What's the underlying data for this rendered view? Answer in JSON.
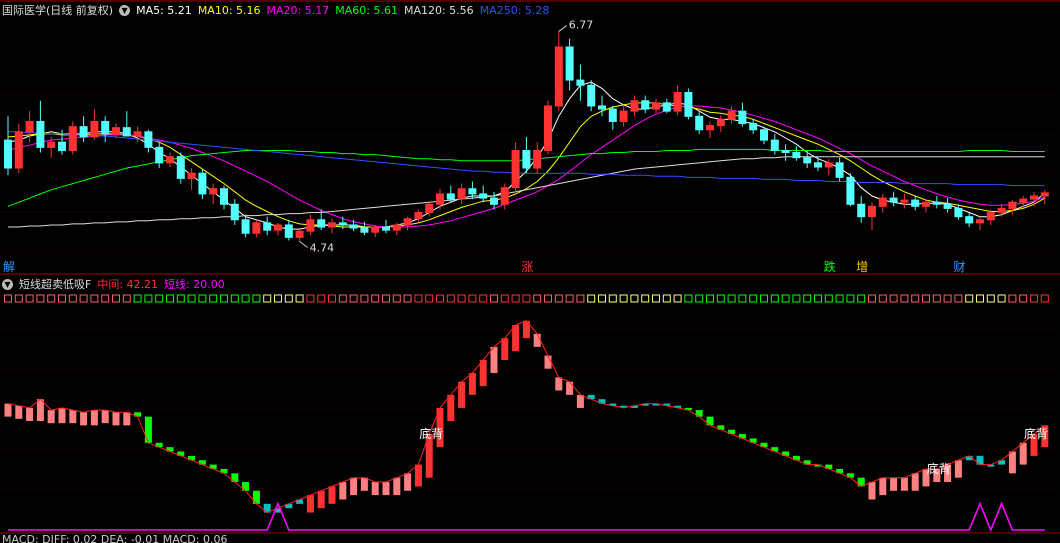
{
  "main_panel": {
    "title": "国际医学(日线 前复权)",
    "ma_labels": [
      {
        "text": "MA5: 5.21",
        "color": "#ffffff"
      },
      {
        "text": "MA10: 5.16",
        "color": "#ffff00"
      },
      {
        "text": "MA20: 5.17",
        "color": "#ff00ff"
      },
      {
        "text": "MA60: 5.61",
        "color": "#00ff00"
      },
      {
        "text": "MA120: 5.56",
        "color": "#dddddd"
      },
      {
        "text": "MA250: 5.28",
        "color": "#3050ff"
      }
    ],
    "high_label": "6.77",
    "low_label": "4.74",
    "markers": [
      {
        "text": "解",
        "index": 0,
        "color": "#3399ff"
      },
      {
        "text": "涨",
        "index": 48,
        "color": "#ff3333"
      },
      {
        "text": "跌",
        "index": 76,
        "color": "#00ff00"
      },
      {
        "text": "增",
        "index": 79,
        "color": "#ffcc00"
      },
      {
        "text": "财",
        "index": 88,
        "color": "#3399ff"
      }
    ]
  },
  "indicator_panel": {
    "title": "短线超卖低吸F",
    "mid_label": "中间: 42.21",
    "short_label": "短线: 20.00",
    "mid_color": "#ff3333",
    "short_color": "#ff00ff",
    "annotation_text": "底背",
    "annotation_indices": [
      39,
      86,
      95
    ]
  },
  "bottom_label": "MACD: DIFF: 0.02  DEA: -0.01  MACD: 0.06",
  "chart_data": {
    "type": "candlestick",
    "ohlc": [
      [
        5.72,
        5.95,
        5.38,
        5.45
      ],
      [
        5.45,
        5.88,
        5.4,
        5.8
      ],
      [
        5.8,
        6.0,
        5.7,
        5.9
      ],
      [
        5.9,
        6.1,
        5.6,
        5.65
      ],
      [
        5.65,
        5.75,
        5.55,
        5.7
      ],
      [
        5.7,
        5.82,
        5.58,
        5.62
      ],
      [
        5.62,
        5.9,
        5.58,
        5.85
      ],
      [
        5.85,
        5.95,
        5.7,
        5.75
      ],
      [
        5.75,
        6.02,
        5.72,
        5.9
      ],
      [
        5.9,
        5.95,
        5.7,
        5.78
      ],
      [
        5.78,
        5.88,
        5.74,
        5.84
      ],
      [
        5.84,
        6.0,
        5.8,
        5.76
      ],
      [
        5.76,
        5.85,
        5.7,
        5.8
      ],
      [
        5.8,
        5.82,
        5.6,
        5.65
      ],
      [
        5.65,
        5.7,
        5.45,
        5.5
      ],
      [
        5.5,
        5.6,
        5.46,
        5.56
      ],
      [
        5.56,
        5.6,
        5.3,
        5.35
      ],
      [
        5.35,
        5.45,
        5.24,
        5.4
      ],
      [
        5.4,
        5.44,
        5.15,
        5.2
      ],
      [
        5.2,
        5.3,
        5.1,
        5.25
      ],
      [
        5.25,
        5.28,
        5.05,
        5.1
      ],
      [
        5.1,
        5.15,
        4.9,
        4.95
      ],
      [
        4.95,
        5.0,
        4.78,
        4.82
      ],
      [
        4.82,
        4.95,
        4.78,
        4.92
      ],
      [
        4.92,
        4.98,
        4.8,
        4.85
      ],
      [
        4.85,
        4.92,
        4.8,
        4.9
      ],
      [
        4.9,
        4.95,
        4.75,
        4.78
      ],
      [
        4.78,
        4.86,
        4.74,
        4.84
      ],
      [
        4.84,
        5.0,
        4.8,
        4.95
      ],
      [
        4.95,
        5.05,
        4.85,
        4.88
      ],
      [
        4.88,
        4.96,
        4.82,
        4.92
      ],
      [
        4.92,
        4.98,
        4.86,
        4.9
      ],
      [
        4.9,
        4.95,
        4.84,
        4.87
      ],
      [
        4.87,
        4.93,
        4.8,
        4.83
      ],
      [
        4.83,
        4.9,
        4.78,
        4.88
      ],
      [
        4.88,
        4.95,
        4.82,
        4.85
      ],
      [
        4.85,
        4.92,
        4.8,
        4.9
      ],
      [
        4.9,
        4.98,
        4.85,
        4.96
      ],
      [
        4.96,
        5.05,
        4.92,
        5.02
      ],
      [
        5.02,
        5.12,
        4.98,
        5.1
      ],
      [
        5.1,
        5.25,
        5.05,
        5.2
      ],
      [
        5.2,
        5.28,
        5.12,
        5.15
      ],
      [
        5.15,
        5.3,
        5.1,
        5.25
      ],
      [
        5.25,
        5.32,
        5.15,
        5.2
      ],
      [
        5.2,
        5.28,
        5.12,
        5.16
      ],
      [
        5.16,
        5.22,
        5.05,
        5.1
      ],
      [
        5.1,
        5.3,
        5.05,
        5.26
      ],
      [
        5.26,
        5.7,
        5.2,
        5.62
      ],
      [
        5.62,
        5.75,
        5.4,
        5.45
      ],
      [
        5.45,
        5.7,
        5.4,
        5.62
      ],
      [
        5.62,
        6.1,
        5.58,
        6.05
      ],
      [
        6.05,
        6.77,
        6.0,
        6.62
      ],
      [
        6.62,
        6.7,
        6.2,
        6.3
      ],
      [
        6.3,
        6.45,
        6.1,
        6.25
      ],
      [
        6.25,
        6.3,
        6.0,
        6.05
      ],
      [
        6.05,
        6.15,
        5.95,
        6.02
      ],
      [
        6.02,
        6.05,
        5.82,
        5.9
      ],
      [
        5.9,
        6.05,
        5.85,
        6.0
      ],
      [
        6.0,
        6.15,
        5.95,
        6.1
      ],
      [
        6.1,
        6.15,
        5.98,
        6.02
      ],
      [
        6.02,
        6.12,
        5.98,
        6.08
      ],
      [
        6.08,
        6.12,
        5.98,
        6.0
      ],
      [
        6.0,
        6.25,
        5.96,
        6.18
      ],
      [
        6.18,
        6.22,
        5.92,
        5.95
      ],
      [
        5.95,
        6.0,
        5.78,
        5.82
      ],
      [
        5.82,
        5.9,
        5.74,
        5.86
      ],
      [
        5.86,
        5.96,
        5.8,
        5.92
      ],
      [
        5.92,
        6.05,
        5.88,
        6.0
      ],
      [
        6.0,
        6.08,
        5.85,
        5.88
      ],
      [
        5.88,
        5.92,
        5.78,
        5.82
      ],
      [
        5.82,
        5.85,
        5.68,
        5.72
      ],
      [
        5.72,
        5.78,
        5.58,
        5.62
      ],
      [
        5.62,
        5.68,
        5.52,
        5.6
      ],
      [
        5.6,
        5.66,
        5.52,
        5.55
      ],
      [
        5.55,
        5.62,
        5.45,
        5.5
      ],
      [
        5.5,
        5.56,
        5.42,
        5.46
      ],
      [
        5.46,
        5.54,
        5.38,
        5.5
      ],
      [
        5.5,
        5.55,
        5.32,
        5.36
      ],
      [
        5.36,
        5.4,
        5.08,
        5.1
      ],
      [
        5.1,
        5.18,
        4.92,
        4.98
      ],
      [
        4.98,
        5.12,
        4.85,
        5.08
      ],
      [
        5.08,
        5.2,
        5.02,
        5.16
      ],
      [
        5.16,
        5.22,
        5.08,
        5.12
      ],
      [
        5.12,
        5.2,
        5.06,
        5.14
      ],
      [
        5.14,
        5.18,
        5.04,
        5.08
      ],
      [
        5.08,
        5.15,
        5.02,
        5.12
      ],
      [
        5.12,
        5.18,
        5.06,
        5.1
      ],
      [
        5.1,
        5.16,
        5.02,
        5.06
      ],
      [
        5.06,
        5.1,
        4.95,
        4.98
      ],
      [
        4.98,
        5.02,
        4.88,
        4.92
      ],
      [
        4.92,
        4.98,
        4.85,
        4.95
      ],
      [
        4.95,
        5.05,
        4.9,
        5.02
      ],
      [
        5.02,
        5.1,
        4.98,
        5.06
      ],
      [
        5.06,
        5.14,
        5.0,
        5.12
      ],
      [
        5.12,
        5.18,
        5.06,
        5.15
      ],
      [
        5.15,
        5.22,
        5.08,
        5.18
      ],
      [
        5.18,
        5.24,
        5.1,
        5.21
      ]
    ],
    "ma": {
      "MA5": [
        5.7,
        5.72,
        5.76,
        5.78,
        5.8,
        5.78,
        5.78,
        5.78,
        5.8,
        5.8,
        5.8,
        5.78,
        5.74,
        5.68,
        5.6,
        5.54,
        5.46,
        5.38,
        5.3,
        5.22,
        5.14,
        5.06,
        4.98,
        4.95,
        4.92,
        4.88,
        4.86,
        4.86,
        4.88,
        4.9,
        4.9,
        4.9,
        4.9,
        4.88,
        4.88,
        4.88,
        4.9,
        4.92,
        4.96,
        5.02,
        5.08,
        5.12,
        5.16,
        5.18,
        5.18,
        5.18,
        5.22,
        5.32,
        5.42,
        5.55,
        5.72,
        5.95,
        6.12,
        6.25,
        6.28,
        6.22,
        6.12,
        6.06,
        6.02,
        6.02,
        6.04,
        6.06,
        6.08,
        6.06,
        6.0,
        5.94,
        5.92,
        5.92,
        5.9,
        5.88,
        5.84,
        5.8,
        5.74,
        5.68,
        5.6,
        5.54,
        5.5,
        5.45,
        5.38,
        5.26,
        5.18,
        5.14,
        5.12,
        5.1,
        5.1,
        5.11,
        5.11,
        5.1,
        5.06,
        5.02,
        4.98,
        4.98,
        5.0,
        5.04,
        5.08,
        5.12,
        5.21
      ],
      "MA10": [
        5.75,
        5.76,
        5.77,
        5.78,
        5.78,
        5.77,
        5.77,
        5.77,
        5.78,
        5.78,
        5.78,
        5.77,
        5.76,
        5.73,
        5.7,
        5.65,
        5.58,
        5.51,
        5.44,
        5.37,
        5.3,
        5.22,
        5.14,
        5.08,
        5.03,
        4.98,
        4.94,
        4.91,
        4.9,
        4.9,
        4.89,
        4.88,
        4.88,
        4.88,
        4.88,
        4.88,
        4.89,
        4.9,
        4.92,
        4.95,
        4.99,
        5.03,
        5.07,
        5.1,
        5.13,
        5.14,
        5.16,
        5.2,
        5.25,
        5.32,
        5.42,
        5.55,
        5.7,
        5.85,
        5.95,
        6.0,
        6.04,
        6.06,
        6.08,
        6.08,
        6.08,
        6.06,
        6.05,
        6.04,
        6.02,
        5.99,
        5.98,
        5.96,
        5.95,
        5.92,
        5.88,
        5.84,
        5.8,
        5.76,
        5.72,
        5.68,
        5.63,
        5.58,
        5.52,
        5.45,
        5.38,
        5.32,
        5.27,
        5.22,
        5.18,
        5.14,
        5.12,
        5.11,
        5.09,
        5.07,
        5.05,
        5.03,
        5.03,
        5.04,
        5.06,
        5.1,
        5.16
      ],
      "MA20": [
        5.62,
        5.65,
        5.67,
        5.7,
        5.72,
        5.73,
        5.74,
        5.75,
        5.76,
        5.77,
        5.77,
        5.77,
        5.76,
        5.74,
        5.72,
        5.7,
        5.67,
        5.64,
        5.6,
        5.56,
        5.52,
        5.47,
        5.42,
        5.37,
        5.32,
        5.26,
        5.2,
        5.14,
        5.09,
        5.04,
        5.0,
        4.96,
        4.93,
        4.91,
        4.89,
        4.88,
        4.88,
        4.88,
        4.89,
        4.9,
        4.92,
        4.94,
        4.97,
        5.0,
        5.03,
        5.06,
        5.1,
        5.14,
        5.18,
        5.22,
        5.28,
        5.34,
        5.42,
        5.5,
        5.58,
        5.65,
        5.72,
        5.79,
        5.86,
        5.92,
        5.97,
        6.01,
        6.04,
        6.05,
        6.05,
        6.04,
        6.03,
        6.01,
        5.99,
        5.96,
        5.93,
        5.9,
        5.86,
        5.82,
        5.78,
        5.74,
        5.69,
        5.64,
        5.59,
        5.53,
        5.47,
        5.42,
        5.37,
        5.32,
        5.28,
        5.24,
        5.2,
        5.17,
        5.14,
        5.12,
        5.1,
        5.09,
        5.09,
        5.1,
        5.11,
        5.13,
        5.17
      ],
      "MA60": [
        5.08,
        5.12,
        5.16,
        5.2,
        5.24,
        5.27,
        5.3,
        5.33,
        5.36,
        5.39,
        5.42,
        5.45,
        5.47,
        5.49,
        5.51,
        5.53,
        5.55,
        5.57,
        5.58,
        5.59,
        5.6,
        5.61,
        5.62,
        5.62,
        5.62,
        5.62,
        5.62,
        5.61,
        5.61,
        5.6,
        5.6,
        5.59,
        5.59,
        5.58,
        5.58,
        5.57,
        5.56,
        5.55,
        5.54,
        5.54,
        5.53,
        5.53,
        5.52,
        5.52,
        5.52,
        5.52,
        5.52,
        5.52,
        5.53,
        5.54,
        5.55,
        5.56,
        5.57,
        5.58,
        5.59,
        5.59,
        5.6,
        5.6,
        5.61,
        5.61,
        5.61,
        5.62,
        5.62,
        5.62,
        5.63,
        5.63,
        5.63,
        5.63,
        5.63,
        5.63,
        5.63,
        5.62,
        5.62,
        5.62,
        5.62,
        5.62,
        5.61,
        5.61,
        5.61,
        5.61,
        5.61,
        5.61,
        5.61,
        5.61,
        5.61,
        5.61,
        5.61,
        5.61,
        5.61,
        5.62,
        5.62,
        5.62,
        5.62,
        5.61,
        5.61,
        5.61,
        5.61
      ],
      "MA120": [
        4.88,
        4.88,
        4.89,
        4.89,
        4.9,
        4.9,
        4.91,
        4.91,
        4.92,
        4.92,
        4.93,
        4.93,
        4.94,
        4.94,
        4.95,
        4.95,
        4.96,
        4.96,
        4.97,
        4.97,
        4.98,
        4.98,
        4.99,
        4.99,
        5.0,
        5.0,
        5.01,
        5.01,
        5.02,
        5.02,
        5.03,
        5.04,
        5.05,
        5.06,
        5.07,
        5.08,
        5.09,
        5.1,
        5.11,
        5.12,
        5.13,
        5.14,
        5.15,
        5.16,
        5.17,
        5.18,
        5.2,
        5.22,
        5.24,
        5.26,
        5.28,
        5.3,
        5.32,
        5.34,
        5.36,
        5.38,
        5.4,
        5.42,
        5.44,
        5.45,
        5.46,
        5.47,
        5.48,
        5.49,
        5.5,
        5.51,
        5.52,
        5.53,
        5.54,
        5.54,
        5.55,
        5.55,
        5.56,
        5.56,
        5.56,
        5.56,
        5.56,
        5.56,
        5.56,
        5.56,
        5.56,
        5.56,
        5.56,
        5.56,
        5.56,
        5.56,
        5.56,
        5.56,
        5.56,
        5.56,
        5.56,
        5.56,
        5.56,
        5.56,
        5.56,
        5.56,
        5.56
      ],
      "MA250": [
        5.8,
        5.8,
        5.79,
        5.79,
        5.78,
        5.78,
        5.77,
        5.77,
        5.76,
        5.76,
        5.75,
        5.74,
        5.73,
        5.72,
        5.71,
        5.7,
        5.69,
        5.68,
        5.67,
        5.66,
        5.65,
        5.64,
        5.63,
        5.62,
        5.61,
        5.6,
        5.59,
        5.58,
        5.57,
        5.56,
        5.55,
        5.54,
        5.53,
        5.52,
        5.51,
        5.5,
        5.49,
        5.48,
        5.47,
        5.46,
        5.45,
        5.44,
        5.43,
        5.42,
        5.42,
        5.41,
        5.41,
        5.4,
        5.4,
        5.4,
        5.4,
        5.4,
        5.4,
        5.4,
        5.39,
        5.39,
        5.39,
        5.38,
        5.38,
        5.38,
        5.37,
        5.37,
        5.37,
        5.36,
        5.36,
        5.36,
        5.35,
        5.35,
        5.35,
        5.35,
        5.34,
        5.34,
        5.34,
        5.33,
        5.33,
        5.33,
        5.32,
        5.32,
        5.32,
        5.31,
        5.31,
        5.31,
        5.31,
        5.3,
        5.3,
        5.3,
        5.3,
        5.3,
        5.29,
        5.29,
        5.29,
        5.29,
        5.29,
        5.28,
        5.28,
        5.28,
        5.28
      ]
    },
    "indicator": [
      58,
      57,
      56,
      60,
      55,
      56,
      55,
      54,
      55,
      55,
      54,
      54,
      52,
      40,
      38,
      36,
      34,
      32,
      30,
      28,
      26,
      22,
      18,
      12,
      8,
      10,
      12,
      14,
      16,
      18,
      20,
      22,
      24,
      24,
      22,
      22,
      24,
      26,
      30,
      44,
      56,
      62,
      68,
      72,
      78,
      84,
      88,
      94,
      96,
      90,
      80,
      70,
      68,
      62,
      60,
      58,
      57,
      56,
      57,
      58,
      58,
      57,
      56,
      55,
      52,
      48,
      46,
      44,
      42,
      40,
      38,
      36,
      34,
      32,
      30,
      30,
      28,
      26,
      24,
      20,
      22,
      24,
      24,
      24,
      26,
      28,
      28,
      30,
      32,
      34,
      30,
      30,
      32,
      36,
      40,
      44,
      48
    ],
    "indicator_colors": [
      "s",
      "s",
      "s",
      "s",
      "s",
      "s",
      "s",
      "s",
      "s",
      "s",
      "s",
      "s",
      "g",
      "g",
      "g",
      "g",
      "g",
      "g",
      "g",
      "g",
      "g",
      "g",
      "g",
      "g",
      "c",
      "c",
      "c",
      "c",
      "r",
      "r",
      "r",
      "s",
      "s",
      "s",
      "s",
      "s",
      "s",
      "s",
      "r",
      "r",
      "r",
      "r",
      "r",
      "r",
      "r",
      "s",
      "r",
      "r",
      "r",
      "s",
      "s",
      "s",
      "s",
      "s",
      "c",
      "c",
      "c",
      "c",
      "c",
      "c",
      "c",
      "c",
      "c",
      "g",
      "g",
      "g",
      "g",
      "g",
      "g",
      "g",
      "g",
      "g",
      "g",
      "g",
      "g",
      "g",
      "g",
      "g",
      "g",
      "g",
      "s",
      "s",
      "s",
      "s",
      "s",
      "s",
      "s",
      "s",
      "s",
      "c",
      "c",
      "c",
      "c",
      "s",
      "s",
      "r",
      "r"
    ],
    "short_line": [
      0,
      0,
      0,
      0,
      0,
      0,
      0,
      0,
      0,
      0,
      0,
      0,
      0,
      0,
      0,
      0,
      0,
      0,
      0,
      0,
      0,
      0,
      0,
      0,
      0,
      12,
      0,
      0,
      0,
      0,
      0,
      0,
      0,
      0,
      0,
      0,
      0,
      0,
      0,
      0,
      0,
      0,
      0,
      0,
      0,
      0,
      0,
      0,
      0,
      0,
      0,
      0,
      0,
      0,
      0,
      0,
      0,
      0,
      0,
      0,
      0,
      0,
      0,
      0,
      0,
      0,
      0,
      0,
      0,
      0,
      0,
      0,
      0,
      0,
      0,
      0,
      0,
      0,
      0,
      0,
      0,
      0,
      0,
      0,
      0,
      0,
      0,
      0,
      0,
      0,
      12,
      0,
      12,
      0,
      0,
      0,
      0
    ],
    "ylim_main": [
      4.6,
      6.9
    ],
    "ylim_indicator": [
      0,
      100
    ]
  }
}
